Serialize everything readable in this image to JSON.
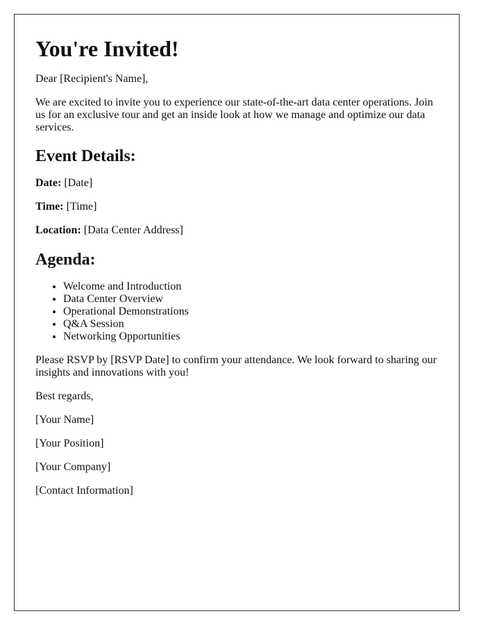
{
  "letter": {
    "title": "You're Invited!",
    "greeting": "Dear [Recipient's Name],",
    "intro": "We are excited to invite you to experience our state-of-the-art data center operations. Join us for an exclusive tour and get an inside look at how we manage and optimize our data services.",
    "event_details": {
      "heading": "Event Details:",
      "items": [
        {
          "label": "Date:",
          "value": "[Date]"
        },
        {
          "label": "Time:",
          "value": "[Time]"
        },
        {
          "label": "Location:",
          "value": "[Data Center Address]"
        }
      ]
    },
    "agenda": {
      "heading": "Agenda:",
      "items": [
        "Welcome and Introduction",
        "Data Center Overview",
        "Operational Demonstrations",
        "Q&A Session",
        "Networking Opportunities"
      ]
    },
    "rsvp": "Please RSVP by [RSVP Date] to confirm your attendance. We look forward to sharing our insights and innovations with you!",
    "closing": "Best regards,",
    "signature": {
      "name": "[Your Name]",
      "position": "[Your Position]",
      "company": "[Your Company]",
      "contact": "[Contact Information]"
    }
  }
}
